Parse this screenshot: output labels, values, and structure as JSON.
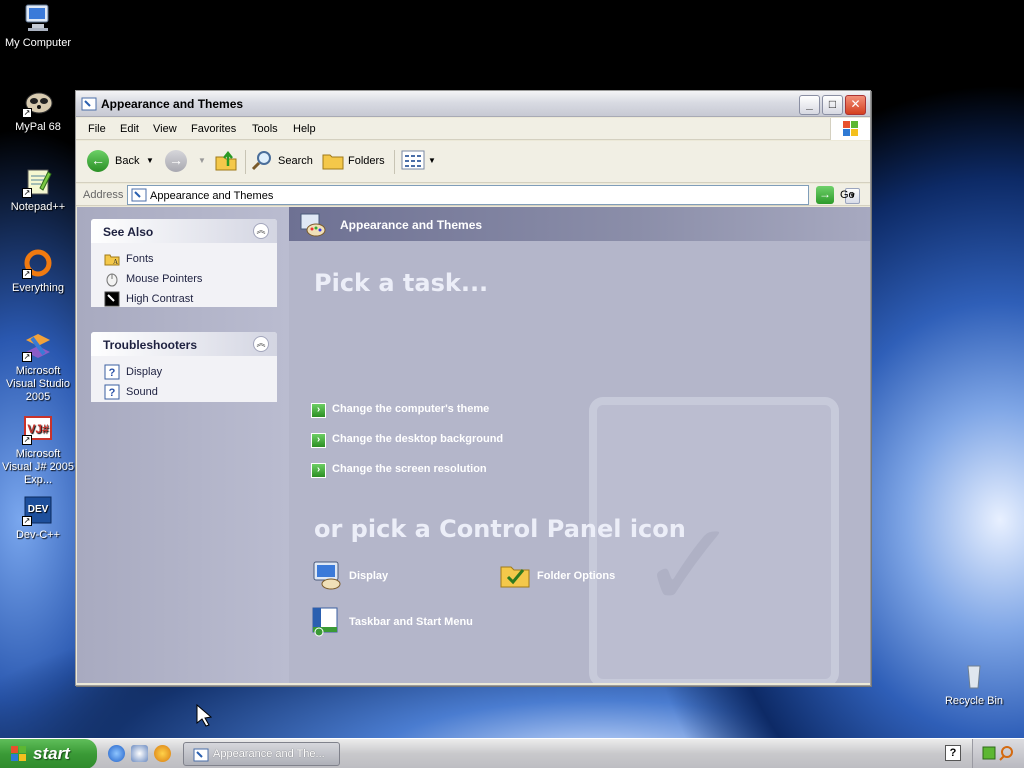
{
  "desktop": {
    "icons": [
      {
        "label": "My Computer"
      },
      {
        "label": "MyPal 68"
      },
      {
        "label": "Notepad++"
      },
      {
        "label": "Everything"
      },
      {
        "label": "Microsoft Visual Studio 2005"
      },
      {
        "label": "Microsoft Visual J# 2005 Exp..."
      },
      {
        "label": "Dev-C++"
      },
      {
        "label": "Recycle Bin"
      }
    ]
  },
  "window": {
    "title": "Appearance and Themes",
    "controls": {
      "minimize": "_",
      "maximize": "□",
      "close": "✕"
    },
    "menu": [
      "File",
      "Edit",
      "View",
      "Favorites",
      "Tools",
      "Help"
    ],
    "toolbar": {
      "back": "Back",
      "search": "Search",
      "folders": "Folders"
    },
    "address": {
      "label": "Address",
      "value": "Appearance and Themes",
      "go": "Go"
    }
  },
  "left_pane": {
    "see_also": {
      "title": "See Also",
      "items": [
        {
          "label": "Fonts",
          "icon": "fonts-folder-icon"
        },
        {
          "label": "Mouse Pointers",
          "icon": "mouse-icon"
        },
        {
          "label": "High Contrast",
          "icon": "high-contrast-icon"
        }
      ]
    },
    "troubleshooters": {
      "title": "Troubleshooters",
      "items": [
        {
          "label": "Display",
          "icon": "help-icon"
        },
        {
          "label": "Sound",
          "icon": "help-icon"
        }
      ]
    }
  },
  "main": {
    "header": "Appearance and Themes",
    "pick_task_heading": "Pick a task...",
    "tasks": [
      "Change the computer's theme",
      "Change the desktop background",
      "Change the screen resolution"
    ],
    "pick_icon_heading": "or pick a Control Panel icon",
    "icons": [
      {
        "label": "Display",
        "icon": "display-icon"
      },
      {
        "label": "Folder Options",
        "icon": "folder-options-icon"
      },
      {
        "label": "Taskbar and Start Menu",
        "icon": "taskbar-icon"
      }
    ]
  },
  "taskbar": {
    "start": "start",
    "task_button": "Appearance and The...",
    "accent": "#3a9a36"
  }
}
